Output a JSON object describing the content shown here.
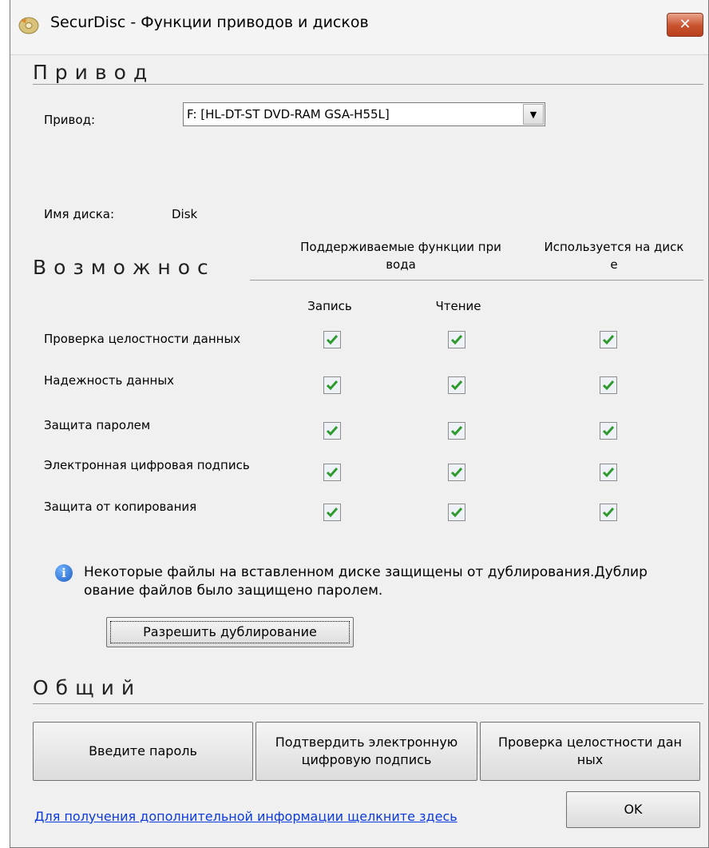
{
  "window": {
    "title": "SecurDisc - Функции приводов и дисков",
    "close_glyph": "✕"
  },
  "drive_section": {
    "title": "Привод",
    "drive_label": "Привод:",
    "drive_value": "F: [HL-DT-ST DVD-RAM GSA-H55L]",
    "disc_name_label": "Имя диска:",
    "disc_name_value": "Disk"
  },
  "features_section": {
    "title": "Возможнос",
    "col_supported": "Поддерживаемые функции при\nвода",
    "col_used": "Используется на диск\nе",
    "col_write": "Запись",
    "col_read": "Чтение",
    "rows": [
      {
        "label": "Проверка целостности данных",
        "write": true,
        "read": true,
        "used": true
      },
      {
        "label": "Надежность данных",
        "write": true,
        "read": true,
        "used": true
      },
      {
        "label": "Защита паролем",
        "write": true,
        "read": true,
        "used": true
      },
      {
        "label": "Электронная цифровая подпись",
        "write": true,
        "read": true,
        "used": true
      },
      {
        "label": "Защита от копирования",
        "write": true,
        "read": true,
        "used": true
      }
    ],
    "info_text": "Некоторые файлы на вставленном диске защищены от дублирования.Дублир\nование файлов было защищено паролем.",
    "allow_dup_button": "Разрешить дублирование"
  },
  "general_section": {
    "title": "Общий",
    "enter_password_button": "Введите пароль",
    "verify_signature_button": "Подтвердить электронную\nцифровую подпись",
    "integrity_check_button": "Проверка целостности дан\nных"
  },
  "footer": {
    "more_info_link": "Для получения дополнительной информации щелкните здесь",
    "ok_button": "OK"
  },
  "colors": {
    "check_green": "#2e9a2e",
    "close_red": "#c8522e",
    "link_blue": "#0a3ae0"
  }
}
